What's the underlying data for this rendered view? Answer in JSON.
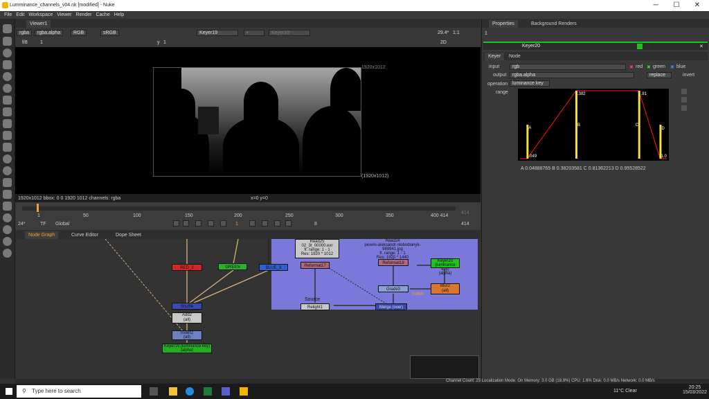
{
  "title": "Lumminance_channels_v04.nk [modified] - Nuke",
  "window_controls": [
    "─",
    "☐",
    "✕"
  ],
  "menu": [
    "File",
    "Edit",
    "Workspace",
    "Viewer",
    "Render",
    "Cache",
    "Help"
  ],
  "viewer": {
    "tab": "Viewer1",
    "channels": "rgba",
    "layer": "rgba.alpha",
    "display": "RGB",
    "lut": "sRGB",
    "input_a": "Keyer19",
    "dash": "-",
    "input_b": "Keyer19",
    "zoom": "29.4*",
    "ratio": "1:1",
    "fstop_label": "f/8",
    "frame_label": "1",
    "y_label": "y",
    "y_val": "1",
    "view_mode": "2D",
    "format_tl": "1920x1012",
    "format_br": "(1920x1012)",
    "info": "1920x1012  bbox: 0 0 1920 1012 channels: rgba",
    "coords": "x=0 y=0"
  },
  "timeline": {
    "ticks": [
      "1",
      "50",
      "100",
      "150",
      "200",
      "250",
      "300",
      "350",
      "400 414"
    ],
    "end_frame": "414",
    "fps": "24*",
    "tf": "TF",
    "global": "Global",
    "current": "1",
    "step": "8",
    "end": "414"
  },
  "node_graph": {
    "tabs": [
      "Node Graph",
      "Curve Editor",
      "Dope Sheet"
    ],
    "nodes": {
      "red": "RED_3",
      "green": "GREEN",
      "blue": "BLUE_3",
      "add": "Add2\n(all)",
      "invert": "Invert2\n(all)",
      "keyer19": "Keyer19 (luminance key)\n(alpha)",
      "read25": "Read25\n02_3t_00000.exr\nfr. range: 1 - 1\nRes: 1920 * 1012",
      "read24": "Read24\npexels-aleksandr-slobodianyk-989941.jpg\nfr. range: 1 - 1\nRes: 1920 * 1440",
      "reformat17": "Reformat17",
      "reformat18": "Reformat18",
      "keyer20": "Keyer20 (luminance key)\n(alpha)",
      "blur2": "Blur2\n(all)",
      "grade3": "Grade3",
      "light1": "Relight1",
      "merge": "Merge (over)",
      "shuffle": "Shuffle",
      "mask_label": "mask",
      "source_label": "Source"
    }
  },
  "properties": {
    "tabs": [
      "Properties",
      "Background Renders"
    ],
    "count": "1",
    "node_name": "Keyer20",
    "subtabs": [
      "Keyer",
      "Node"
    ],
    "input_label": "input",
    "input_val": "rgb",
    "chk_red": "red",
    "chk_green": "green",
    "chk_blue": "blue",
    "output_label": "output",
    "output_val": "rgba.alpha",
    "replace": "replace",
    "invert": "invert",
    "operation_label": "operation",
    "operation_val": "luminance key",
    "range_label": "range",
    "curve_labels": {
      "a": "A",
      "b": "B",
      "c": "C",
      "d": "D",
      "v049": ".049",
      "v382": ".382",
      "v81": ".81",
      "v1": "1.0"
    },
    "range_values": {
      "A": "0.04888765",
      "B": "0.38203581",
      "C": "0.81362213",
      "D": "0.95528522"
    },
    "curve": {
      "a": 0.049,
      "b": 0.382,
      "c": 0.81,
      "d": 0.955
    }
  },
  "status": "Channel Count: 23  Localization Mode: On  Memory: 3.0 GB (18.9%)  CPU: 1.6%  Disk: 0.0 MB/s  Network: 0.0 MB/s",
  "taskbar": {
    "search": "Type here to search",
    "weather": "11°C  Clear",
    "time": "20:25",
    "date": "15/03/2022"
  },
  "colors": {
    "accent": "#f0a030",
    "node_bg": "#7a78d8",
    "keyer_green": "#22c022",
    "curve_red": "#e01010",
    "curve_yellow": "#f2e040"
  }
}
